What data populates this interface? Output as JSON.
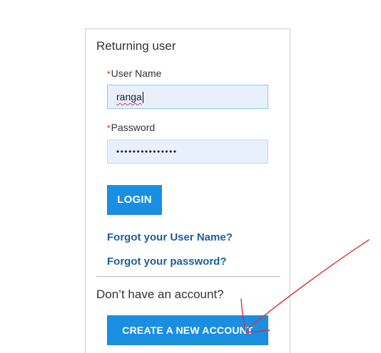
{
  "login_panel": {
    "title": "Returning user",
    "username": {
      "required_marker": "*",
      "label": "User Name",
      "value": "ranga"
    },
    "password": {
      "required_marker": "*",
      "label": "Password",
      "masked_value": "•••••••••••••••"
    },
    "login_button": "LOGIN",
    "forgot_username_link": "Forgot your User Name?",
    "forgot_password_link": "Forgot your password?"
  },
  "signup": {
    "prompt": "Don’t have an account?",
    "create_account_button": "CREATE A NEW ACCOUNT"
  },
  "colors": {
    "button": "#1a8ee1",
    "link": "#1c5f9e",
    "input_bg": "#e8f0fe",
    "annotation": "#e03030"
  }
}
